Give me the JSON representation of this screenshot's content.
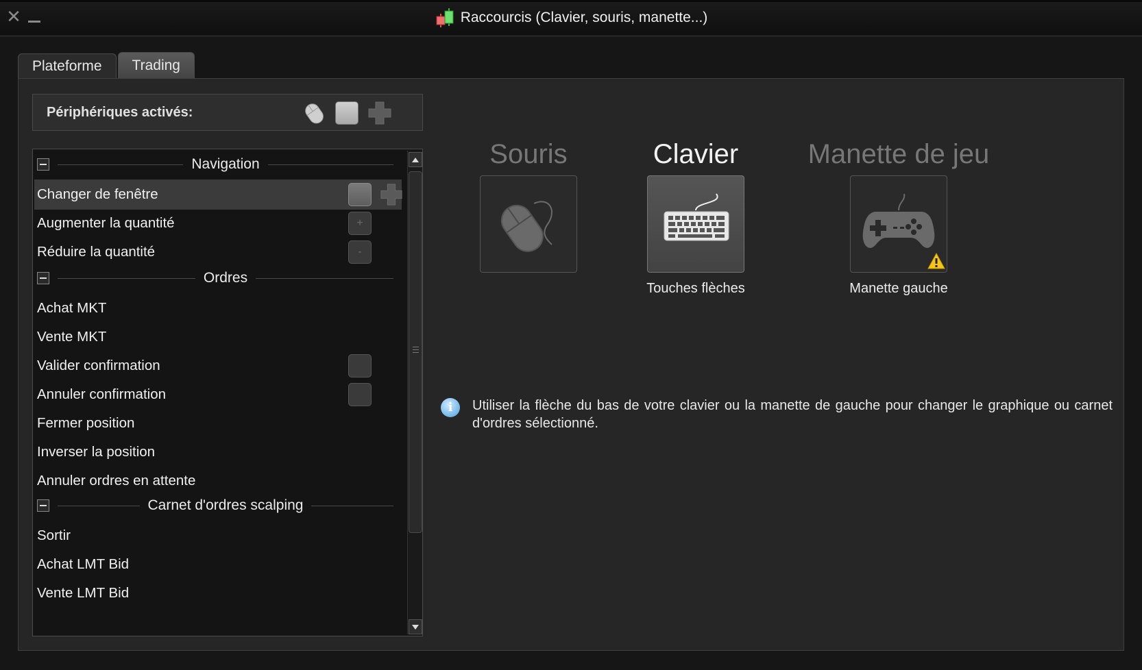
{
  "window": {
    "title": "Raccourcis (Clavier, souris, manette...)",
    "close_icon": "close-icon",
    "minimize_icon": "minimize-icon"
  },
  "tabs": [
    {
      "label": "Plateforme",
      "active": false
    },
    {
      "label": "Trading",
      "active": true
    }
  ],
  "peripherals": {
    "label": "Périphériques activés:",
    "icons": [
      "mouse-icon",
      "keyboard-key-icon",
      "gamepad-dpad-icon"
    ]
  },
  "shortcut_list": {
    "sections": [
      {
        "title": "Navigation",
        "items": [
          {
            "label": "Changer de fenêtre",
            "selected": true,
            "keys": [
              "key",
              "dpad"
            ]
          },
          {
            "label": "Augmenter la quantité",
            "keys": [
              "+"
            ]
          },
          {
            "label": "Réduire la quantité",
            "keys": [
              "-"
            ]
          }
        ]
      },
      {
        "title": "Ordres",
        "items": [
          {
            "label": "Achat MKT"
          },
          {
            "label": "Vente MKT"
          },
          {
            "label": "Valider confirmation",
            "keys": [
              "key"
            ]
          },
          {
            "label": "Annuler confirmation",
            "keys": [
              "key"
            ]
          },
          {
            "label": "Fermer position"
          },
          {
            "label": "Inverser la position"
          },
          {
            "label": "Annuler ordres en attente"
          }
        ]
      },
      {
        "title": "Carnet d'ordres scalping",
        "items": [
          {
            "label": "Sortir"
          },
          {
            "label": "Achat LMT Bid"
          },
          {
            "label": "Vente LMT Bid"
          }
        ]
      }
    ]
  },
  "devices": [
    {
      "title": "Souris",
      "active": false,
      "icon": "mouse-icon",
      "caption": ""
    },
    {
      "title": "Clavier",
      "active": true,
      "icon": "keyboard-icon",
      "caption": "Touches flèches"
    },
    {
      "title": "Manette de jeu",
      "active": false,
      "icon": "gamepad-icon",
      "caption": "Manette gauche",
      "warning": true
    }
  ],
  "info": {
    "icon": "info-icon",
    "text": "Utiliser la flèche du bas de votre clavier ou la manette de gauche pour changer le graphique ou carnet d'ordres sélectionné."
  },
  "colors": {
    "background": "#262626",
    "selected_row": "#3b3b3b",
    "info_icon": "#4aa3e0",
    "warning": "#f5c518"
  }
}
